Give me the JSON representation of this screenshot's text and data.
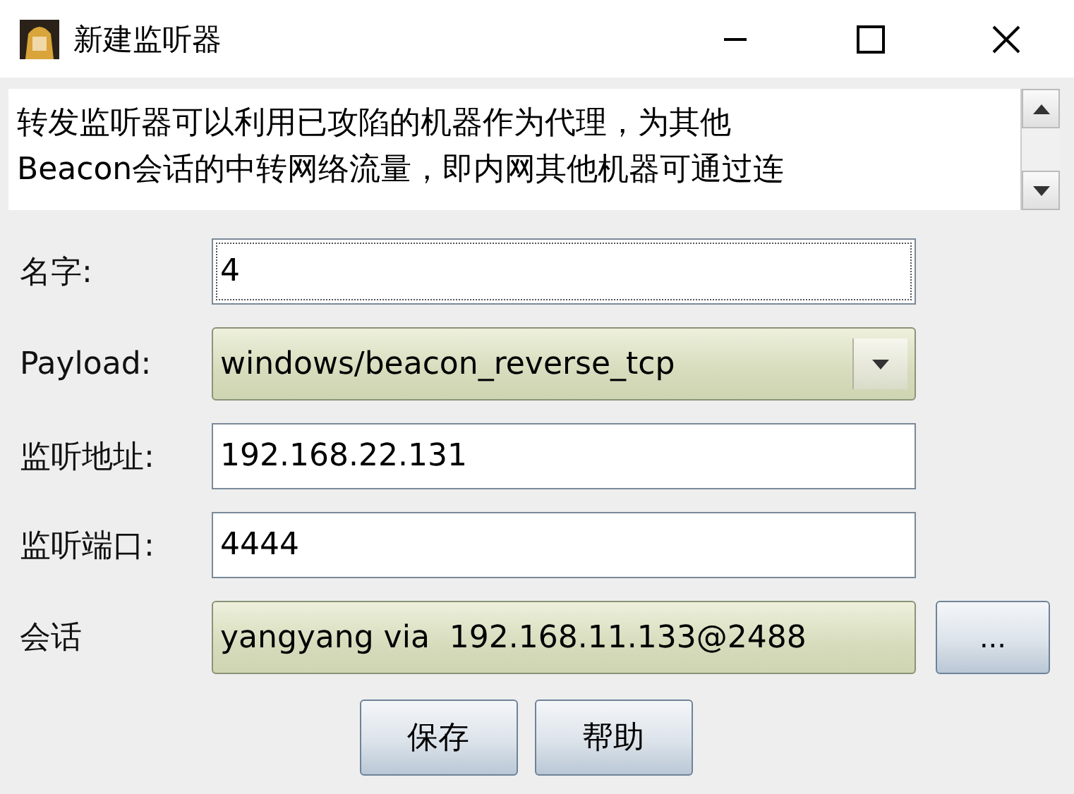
{
  "window": {
    "title": "新建监听器"
  },
  "description": {
    "lines": [
      "转发监听器可以利用已攻陷的机器作为代理，为其他",
      "Beacon会话的中转网络流量，即内网其他机器可通过连"
    ]
  },
  "fields": [
    {
      "kind": "text",
      "label": "名字:",
      "value": "4",
      "focused": true
    },
    {
      "kind": "combo",
      "label": "Payload:",
      "value": "windows/beacon_reverse_tcp",
      "focused": false
    },
    {
      "kind": "text",
      "label": "监听地址:",
      "value": "192.168.22.131",
      "focused": false
    },
    {
      "kind": "text",
      "label": "监听端口:",
      "value": "4444",
      "focused": false
    },
    {
      "kind": "picker",
      "label": "会话",
      "value": "yangyang via  192.168.11.133@2488",
      "button": "...",
      "focused": false
    }
  ],
  "buttons": [
    "保存",
    "帮助"
  ]
}
